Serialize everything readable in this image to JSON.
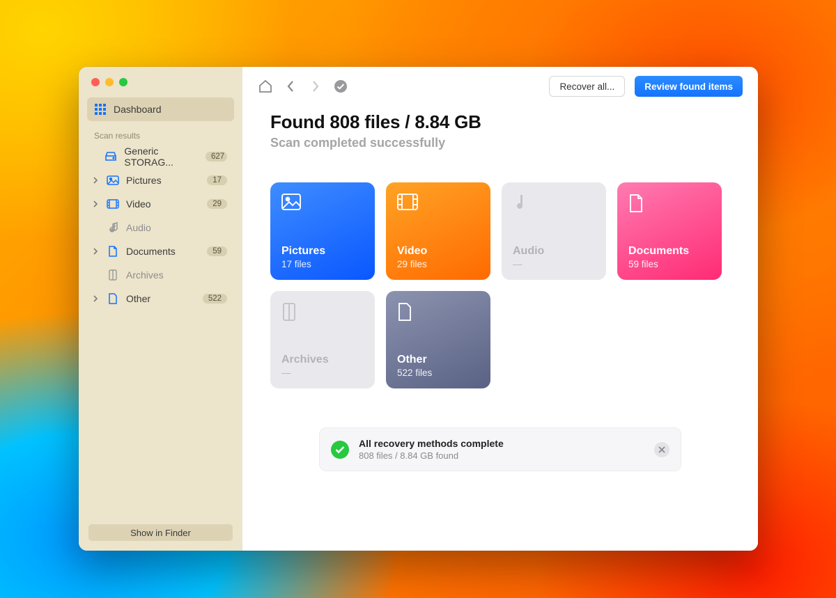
{
  "sidebar": {
    "dashboard_label": "Dashboard",
    "section_label": "Scan results",
    "items": [
      {
        "label": "Generic STORAG...",
        "count": "627",
        "expandable": false,
        "icon": "drive"
      },
      {
        "label": "Pictures",
        "count": "17",
        "expandable": true,
        "icon": "image"
      },
      {
        "label": "Video",
        "count": "29",
        "expandable": true,
        "icon": "video"
      },
      {
        "label": "Audio",
        "count": "",
        "expandable": false,
        "icon": "audio"
      },
      {
        "label": "Documents",
        "count": "59",
        "expandable": true,
        "icon": "doc"
      },
      {
        "label": "Archives",
        "count": "",
        "expandable": false,
        "icon": "archive"
      },
      {
        "label": "Other",
        "count": "522",
        "expandable": true,
        "icon": "other"
      }
    ],
    "finder_button": "Show in Finder"
  },
  "toolbar": {
    "recover_all": "Recover all...",
    "review": "Review found items"
  },
  "summary": {
    "headline": "Found 808 files / 8.84 GB",
    "subhead": "Scan completed successfully"
  },
  "cards": {
    "pictures": {
      "title": "Pictures",
      "sub": "17 files"
    },
    "video": {
      "title": "Video",
      "sub": "29 files"
    },
    "audio": {
      "title": "Audio",
      "sub": "—"
    },
    "documents": {
      "title": "Documents",
      "sub": "59 files"
    },
    "archives": {
      "title": "Archives",
      "sub": "—"
    },
    "other": {
      "title": "Other",
      "sub": "522 files"
    }
  },
  "toast": {
    "title": "All recovery methods complete",
    "detail": "808 files / 8.84 GB found"
  }
}
